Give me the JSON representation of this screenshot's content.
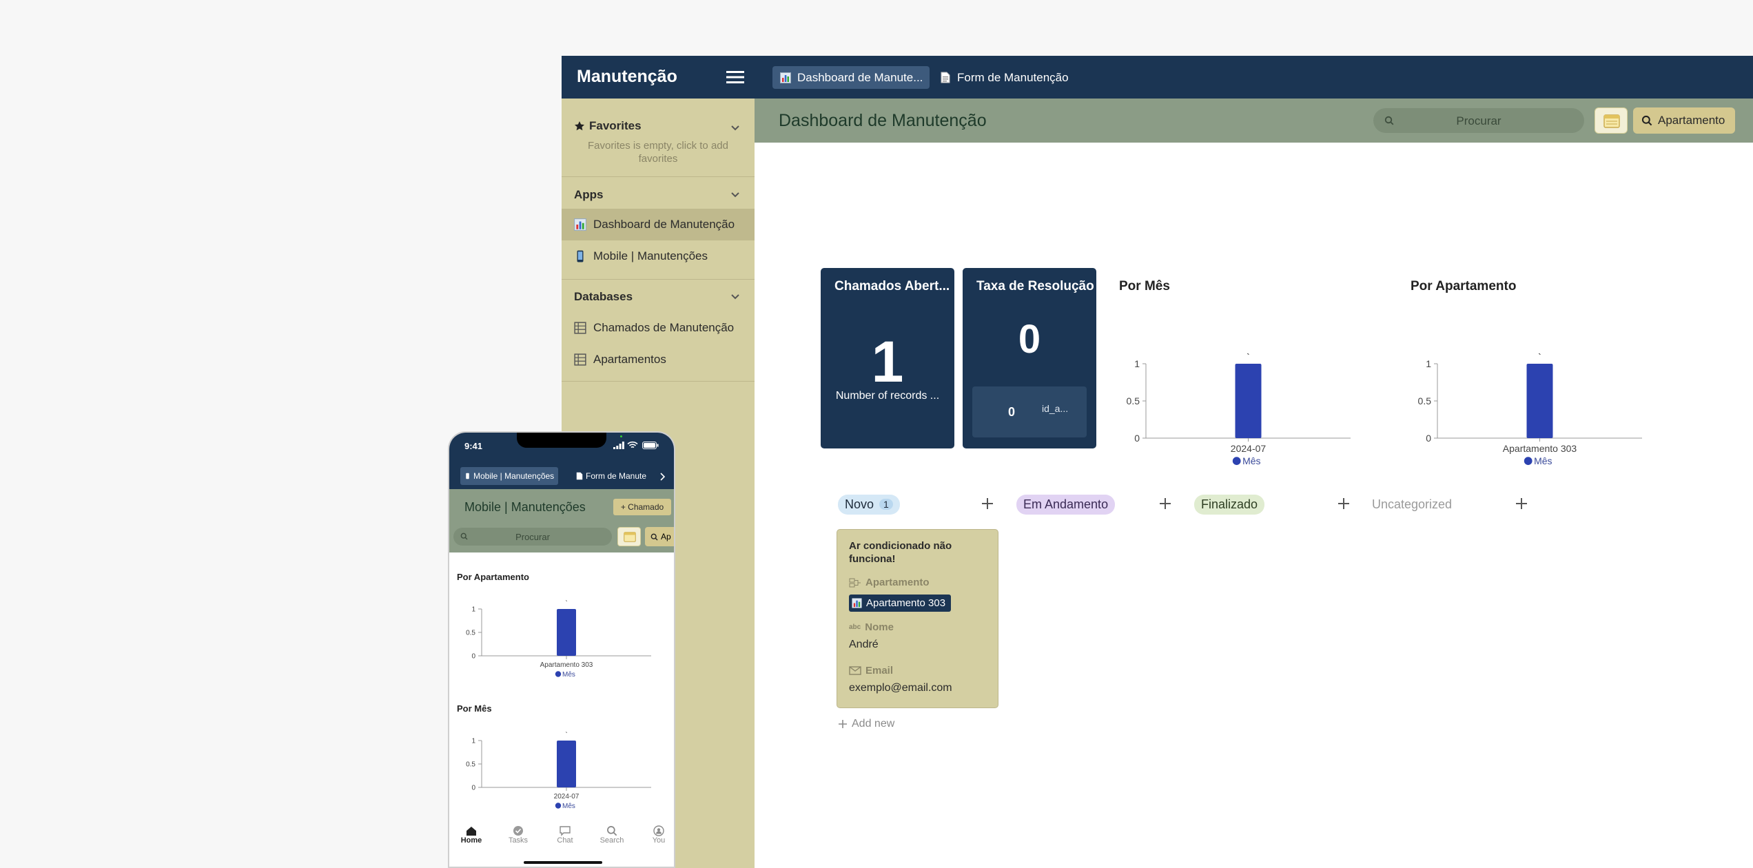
{
  "desktop": {
    "app_name": "Manutenção",
    "tabs": [
      {
        "label": "Dashboard de Manute...",
        "icon": "bar-chart-icon"
      },
      {
        "label": "Form de Manutenção",
        "icon": "document-icon"
      }
    ],
    "sidebar": {
      "favorites": {
        "title": "Favorites",
        "empty_text_line1": "Favorites is empty, click to add",
        "empty_text_line2": "favorites"
      },
      "apps": {
        "title": "Apps",
        "items": [
          "Dashboard de Manutenção",
          "Mobile | Manutenções"
        ]
      },
      "databases": {
        "title": "Databases",
        "items": [
          "Chamados de Manutenção",
          "Apartamentos"
        ]
      }
    },
    "header": {
      "title": "Dashboard de Manutenção",
      "search_placeholder": "Procurar",
      "filter_label": "Apartamento"
    },
    "kpis": [
      {
        "title": "Chamados Abert...",
        "value": "1",
        "caption": "Number of records ..."
      },
      {
        "title": "Taxa de Resolução",
        "value": "0",
        "sub_value": "0",
        "sub_label": "id_a..."
      }
    ],
    "kanban": {
      "columns": [
        {
          "label": "Novo",
          "count": "1",
          "bg": "#d5e8f6"
        },
        {
          "label": "Em Andamento",
          "bg": "#e1d3f3"
        },
        {
          "label": "Finalizado",
          "bg": "#e0ecd0"
        },
        {
          "label": "Uncategorized"
        }
      ],
      "card": {
        "title_line1": "Ar condicionado não",
        "title_line2": "funciona!",
        "fields": [
          {
            "label": "Apartamento",
            "value": "Apartamento 303"
          },
          {
            "label": "Nome",
            "value": "André"
          },
          {
            "label": "Email",
            "value": "exemplo@email.com"
          }
        ]
      },
      "add_new": "Add new"
    }
  },
  "mobile": {
    "time": "9:41",
    "tabs": [
      "Mobile | Manutenções",
      "Form de Manute"
    ],
    "title": "Mobile | Manutenções",
    "add_button": "+ Chamado",
    "search_placeholder": "Procurar",
    "filter_label": "Ap",
    "nav": [
      "Home",
      "Tasks",
      "Chat",
      "Search",
      "You"
    ]
  },
  "chart_data": [
    {
      "type": "bar",
      "title": "Por Mês",
      "categories": [
        "2024-07"
      ],
      "series": [
        {
          "name": "Mês",
          "values": [
            1
          ]
        }
      ],
      "yticks": [
        "0",
        "0.5",
        "1"
      ],
      "ylim": [
        0,
        1
      ],
      "data_label": "`",
      "legend": "bottom",
      "color": "#2c42b0"
    },
    {
      "type": "bar",
      "title": "Por Apartamento",
      "categories": [
        "Apartamento 303"
      ],
      "series": [
        {
          "name": "Mês",
          "values": [
            1
          ]
        }
      ],
      "yticks": [
        "0",
        "0.5",
        "1"
      ],
      "ylim": [
        0,
        1
      ],
      "data_label": "`",
      "legend": "bottom",
      "color": "#2c42b0"
    }
  ]
}
